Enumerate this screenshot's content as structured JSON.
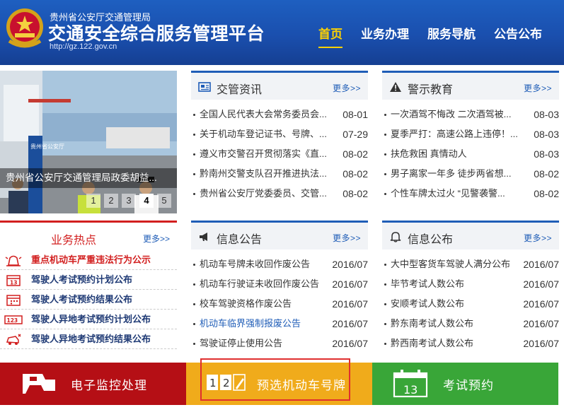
{
  "header": {
    "org": "贵州省公安厅交通管理局",
    "title": "交通安全综合服务管理平台",
    "url": "http://gz.122.gov.cn",
    "nav": [
      {
        "label": "首页",
        "active": true
      },
      {
        "label": "业务办理",
        "active": false
      },
      {
        "label": "服务导航",
        "active": false
      },
      {
        "label": "公告公布",
        "active": false
      }
    ]
  },
  "slider": {
    "caption": "贵州省公安厅交通管理局政委胡益...",
    "pages": [
      "1",
      "2",
      "3",
      "4",
      "5"
    ],
    "active_page": "4"
  },
  "panels": {
    "traffic_news": {
      "title": "交管资讯",
      "more": "更多>>",
      "icon": "newspaper-icon",
      "items": [
        {
          "title": "全国人民代表大会常务委员会...",
          "date": "08-01"
        },
        {
          "title": "关于机动车登记证书、号牌、...",
          "date": "07-29"
        },
        {
          "title": "遵义市交警召开贯彻落实《直...",
          "date": "08-02"
        },
        {
          "title": "黔南州交警支队召开推进执法...",
          "date": "08-02"
        },
        {
          "title": "贵州省公安厅党委委员、交管...",
          "date": "08-02"
        }
      ]
    },
    "warning": {
      "title": "警示教育",
      "more": "更多>>",
      "icon": "warning-icon",
      "items": [
        {
          "title": "一次酒驾不悔改 二次酒驾被...",
          "date": "08-03"
        },
        {
          "title": "夏季严打：高速公路上违停！...",
          "date": "08-03"
        },
        {
          "title": "扶危救困 真情动人",
          "date": "08-03"
        },
        {
          "title": "男子离家一年多 徒步两省想...",
          "date": "08-02"
        },
        {
          "title": "个性车牌太过火 “见警袭警...",
          "date": "08-02"
        }
      ]
    },
    "info_notice": {
      "title": "信息公告",
      "more": "更多>>",
      "icon": "megaphone-icon",
      "items": [
        {
          "title": "机动车号牌未收回作废公告",
          "date": "2016/07"
        },
        {
          "title": "机动车行驶证未收回作废公告",
          "date": "2016/07"
        },
        {
          "title": "校车驾驶资格作废公告",
          "date": "2016/07"
        },
        {
          "title": "机动车临界强制报废公告",
          "date": "2016/07"
        },
        {
          "title": "驾驶证停止使用公告",
          "date": "2016/07"
        }
      ]
    },
    "info_publish": {
      "title": "信息公布",
      "more": "更多>>",
      "icon": "bell-icon",
      "items": [
        {
          "title": "大中型客货车驾驶人满分公布",
          "date": "2016/07"
        },
        {
          "title": "毕节考试人数公布",
          "date": "2016/07"
        },
        {
          "title": "安顺考试人数公布",
          "date": "2016/07"
        },
        {
          "title": "黔东南考试人数公布",
          "date": "2016/07"
        },
        {
          "title": "黔西南考试人数公布",
          "date": "2016/07"
        }
      ]
    }
  },
  "hot": {
    "title": "业务热点",
    "more": "更多>>",
    "items": [
      {
        "label": "重点机动车严重违法行为公示",
        "icon": "alarm-icon"
      },
      {
        "label": "驾驶人考试预约计划公布",
        "icon": "calendar-icon"
      },
      {
        "label": "驾驶人考试预约结果公布",
        "icon": "calendar-result-icon"
      },
      {
        "label": "驾驶人异地考试预约计划公布",
        "icon": "number-board-icon"
      },
      {
        "label": "驾驶人异地考试预约结果公布",
        "icon": "car-crash-icon"
      }
    ]
  },
  "quick_links": {
    "monitor": {
      "label": "电子监控处理",
      "icon": "camera-icon",
      "color": "#b50f15"
    },
    "plate": {
      "label": "预选机动车号牌",
      "icon": "plate-number-icon",
      "icon_text": [
        "1",
        "2"
      ],
      "color": "#f0ab1b"
    },
    "exam": {
      "label": "考试预约",
      "icon": "calendar-icon",
      "icon_text": "13",
      "color": "#39a638"
    }
  }
}
